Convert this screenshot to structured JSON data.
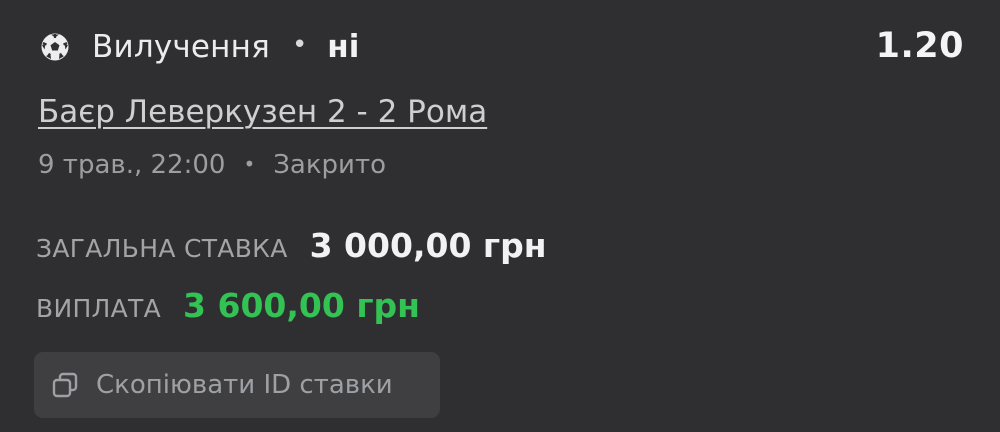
{
  "bet": {
    "sport_icon": "soccer-ball-icon",
    "market": "Вилучення",
    "separator": "•",
    "selection": "ні",
    "odds": "1.20",
    "event": "Баєр Леверкузен 2 - 2 Рома",
    "date_time": "9 трав., 22:00",
    "meta_separator": "•",
    "status": "Закрито",
    "stake_label": "ЗАГАЛЬНА СТАВКА",
    "stake_value": "3 000,00 грн",
    "payout_label": "ВИПЛАТА",
    "payout_value": "3 600,00 грн",
    "payout_color": "#33c254",
    "copy_icon": "copy-icon",
    "copy_label": "Скопіювати ID ставки"
  }
}
